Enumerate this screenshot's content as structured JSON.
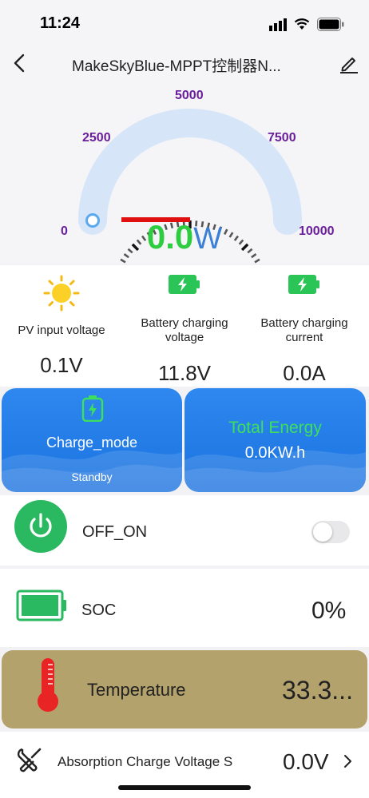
{
  "status_bar": {
    "time": "11:24"
  },
  "nav": {
    "title": "MakeSkyBlue-MPPT控制器N..."
  },
  "gauge": {
    "ticks": [
      "0",
      "2500",
      "5000",
      "7500",
      "10000"
    ],
    "value": "0.0",
    "unit": "W",
    "level": 0
  },
  "readings": [
    {
      "label_lines": [
        "PV input voltage"
      ],
      "value": "0.1V",
      "icon": "sun-icon"
    },
    {
      "label_lines": [
        "Battery charging",
        "voltage"
      ],
      "value": "11.8V",
      "icon": "battery-charging-icon"
    },
    {
      "label_lines": [
        "Battery charging",
        "current"
      ],
      "value": "0.0A",
      "icon": "battery-charging-icon"
    }
  ],
  "mode_card": {
    "label": "Charge_mode",
    "status": "Standby"
  },
  "energy_card": {
    "title": "Total Energy",
    "value": "0.0KW.h"
  },
  "power_row": {
    "label": "OFF_ON",
    "toggle_on": false
  },
  "soc_row": {
    "label": "SOC",
    "value": "0%"
  },
  "temp_row": {
    "label": "Temperature",
    "value": "33.3..."
  },
  "setting_row": {
    "label": "Absorption Charge Voltage S",
    "value": "0.0V"
  },
  "colors": {
    "accent_blue": "#1b73e0",
    "green": "#2ab860",
    "gauge_label": "#6a1e9c",
    "temp_bg": "#b4a26d"
  }
}
